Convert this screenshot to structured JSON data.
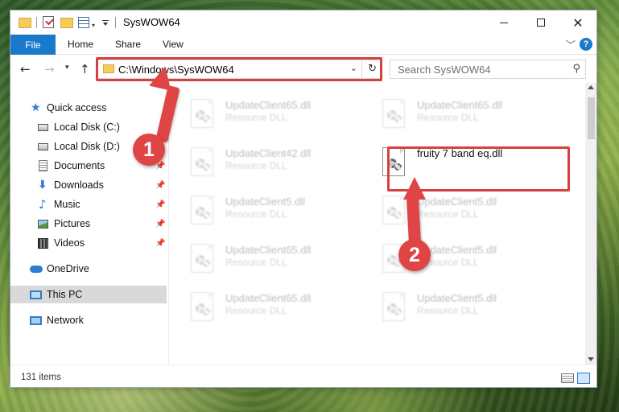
{
  "window": {
    "title": "SysWOW64",
    "min_icon": "minimize-icon",
    "max_icon": "maximize-icon",
    "close_glyph": "✕"
  },
  "ribbon": {
    "tabs": [
      "File",
      "Home",
      "Share",
      "View"
    ],
    "accent_color": "#1979ca",
    "help_glyph": "?"
  },
  "address": {
    "path": "C:\\Windows\\SysWOW64",
    "search_placeholder": "Search SysWOW64"
  },
  "nav": {
    "items": [
      {
        "label": "Quick access",
        "icon": "quick-access-star-icon"
      },
      {
        "label": "Local Disk (C:)",
        "icon": "drive-icon"
      },
      {
        "label": "Local Disk (D:)",
        "icon": "drive-icon"
      },
      {
        "label": "Documents",
        "icon": "documents-icon",
        "pinned": true
      },
      {
        "label": "Downloads",
        "icon": "downloads-icon",
        "pinned": true
      },
      {
        "label": "Music",
        "icon": "music-icon",
        "pinned": true
      },
      {
        "label": "Pictures",
        "icon": "pictures-icon",
        "pinned": true
      },
      {
        "label": "Videos",
        "icon": "videos-icon",
        "pinned": true
      },
      {
        "label": "OneDrive",
        "icon": "onedrive-icon"
      },
      {
        "label": "This PC",
        "icon": "this-pc-icon",
        "selected": true
      },
      {
        "label": "Network",
        "icon": "network-icon"
      }
    ]
  },
  "files": [
    {
      "name": "UpdateClient65.dll",
      "type": "Resource DLL",
      "faded": true
    },
    {
      "name": "UpdateClient65.dll",
      "type": "Resource DLL",
      "faded": true
    },
    {
      "name": "UpdateClient42.dll",
      "type": "Resource DLL",
      "faded": true
    },
    {
      "name": "fruity 7 band eq.dll",
      "type": "",
      "faded": false
    },
    {
      "name": "UpdateClient5.dll",
      "type": "Resource DLL",
      "faded": true
    },
    {
      "name": "UpdateClient5.dll",
      "type": "Resource DLL",
      "faded": true
    },
    {
      "name": "UpdateClient65.dll",
      "type": "Resource DLL",
      "faded": true
    },
    {
      "name": "UpdateClient5.dll",
      "type": "Resource DLL",
      "faded": true
    },
    {
      "name": "UpdateClient65.dll",
      "type": "Resource DLL",
      "faded": true
    },
    {
      "name": "UpdateClient5.dll",
      "type": "Resource DLL",
      "faded": true
    }
  ],
  "status": {
    "item_count": "131 items"
  },
  "annotations": {
    "step1": "1",
    "step2": "2",
    "highlight_color": "#d84040"
  }
}
